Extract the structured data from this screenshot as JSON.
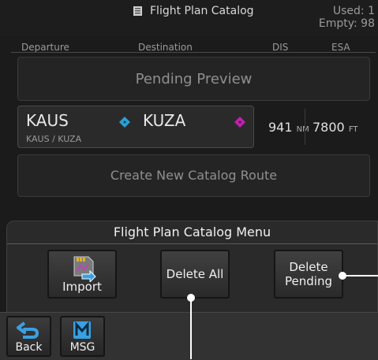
{
  "header": {
    "title": "Flight Plan Catalog",
    "used_label": "Used: 1",
    "empty_label": "Empty: 98"
  },
  "columns": {
    "departure": "Departure",
    "destination": "Destination",
    "dis": "DIS",
    "esa": "ESA"
  },
  "pending_preview": "Pending Preview",
  "route": {
    "departure": "KAUS",
    "destination": "KUZA",
    "route_id": "KAUS / KUZA",
    "distance": "941",
    "distance_unit": "NM",
    "esa": "7800",
    "esa_unit": "FT"
  },
  "create_route": "Create New Catalog Route",
  "menu": {
    "title": "Flight Plan Catalog Menu",
    "import_label": "Import",
    "delete_all_label": "Delete All",
    "delete_pending_line1": "Delete",
    "delete_pending_line2": "Pending"
  },
  "bottom": {
    "back_label": "Back",
    "msg_label": "MSG"
  },
  "colors": {
    "departure_marker": "#2a9fd6",
    "destination_marker": "#c020b0"
  }
}
